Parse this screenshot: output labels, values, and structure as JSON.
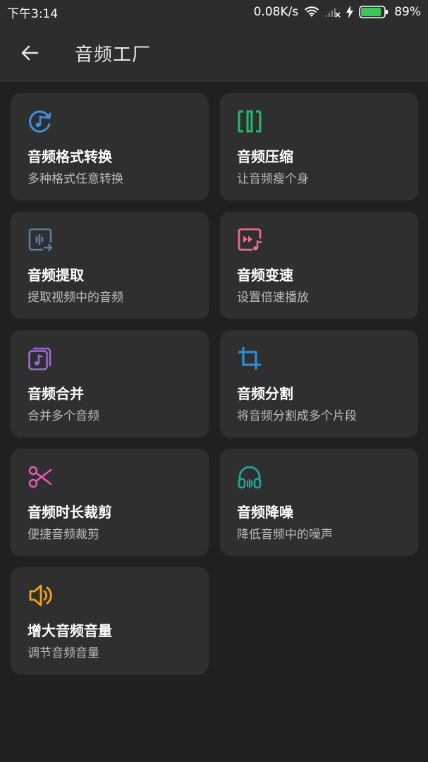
{
  "status_bar": {
    "time": "下午3:14",
    "network_speed": "0.08K/s",
    "battery_percent": "89%",
    "battery_level": 0.89,
    "battery_color": "#34c759",
    "icons": [
      "wifi-icon",
      "signal-icon",
      "charging-icon",
      "battery-icon"
    ]
  },
  "app_bar": {
    "back_icon": "arrow-left-icon",
    "title": "音频工厂"
  },
  "tools": [
    {
      "title": "音频格式转换",
      "subtitle": "多种格式任意转换",
      "icon": "music-convert-icon",
      "color": "#3d8fe0"
    },
    {
      "title": "音频压缩",
      "subtitle": "让音频瘦个身",
      "icon": "compress-icon",
      "color": "#27b36a"
    },
    {
      "title": "音频提取",
      "subtitle": "提取视频中的音频",
      "icon": "extract-icon",
      "color": "#5a7fa6"
    },
    {
      "title": "音频变速",
      "subtitle": "设置倍速播放",
      "icon": "speed-icon",
      "color": "#f06a8a"
    },
    {
      "title": "音频合并",
      "subtitle": "合并多个音频",
      "icon": "merge-icon",
      "color": "#9b6bd6"
    },
    {
      "title": "音频分割",
      "subtitle": "将音频分割成多个片段",
      "icon": "crop-icon",
      "color": "#2c8fd8"
    },
    {
      "title": "音频时长裁剪",
      "subtitle": "便捷音频裁剪",
      "icon": "scissors-icon",
      "color": "#e858b8"
    },
    {
      "title": "音频降噪",
      "subtitle": "降低音频中的噪声",
      "icon": "headphones-icon",
      "color": "#1fa79a"
    },
    {
      "title": "增大音频音量",
      "subtitle": "调节音频音量",
      "icon": "volume-icon",
      "color": "#f3a21b"
    }
  ]
}
